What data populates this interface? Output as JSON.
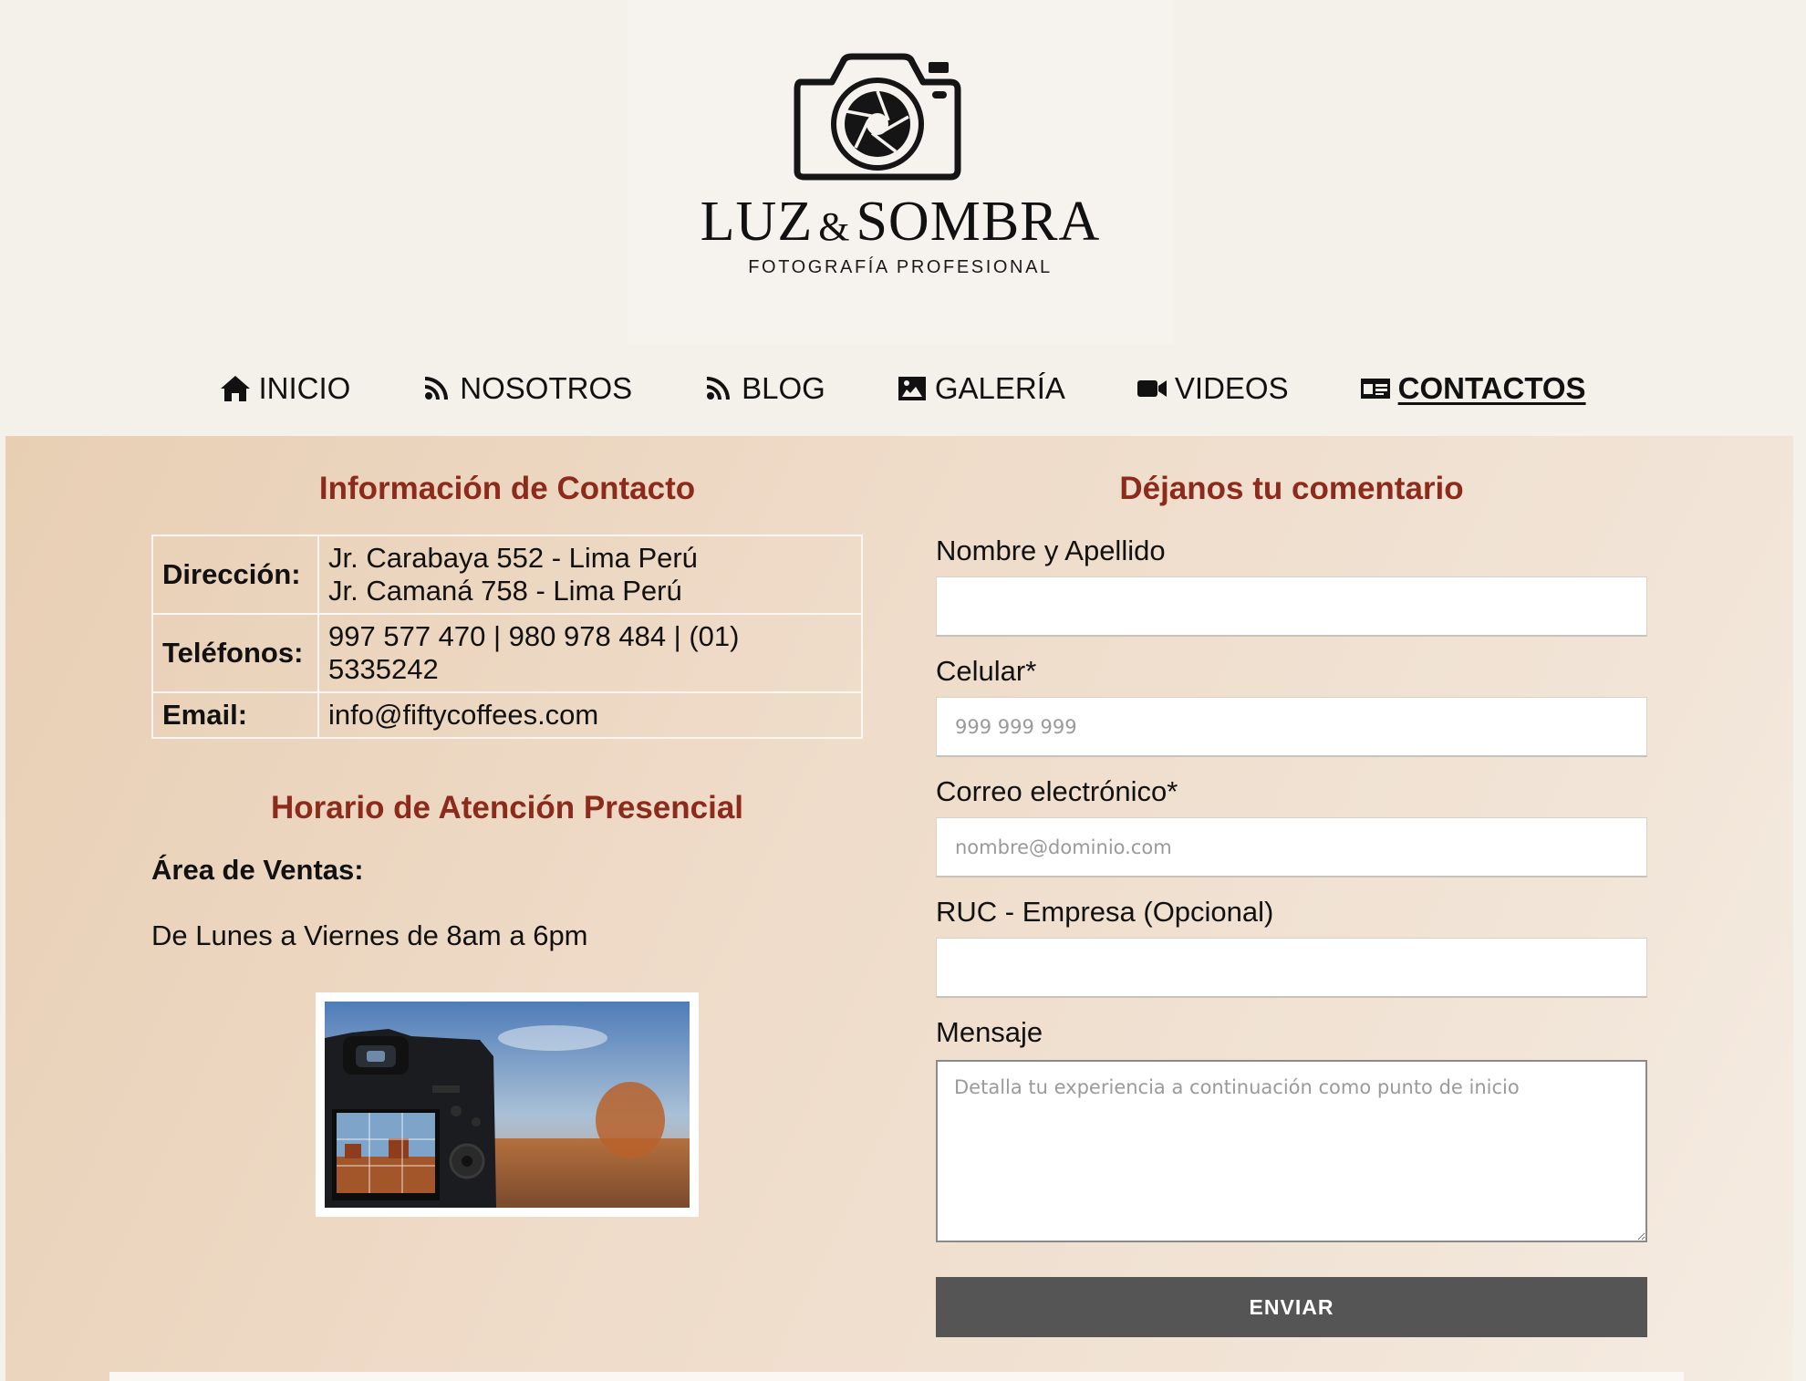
{
  "brand": {
    "name_left": "LUZ",
    "ampersand": "&",
    "name_right": "SOMBRA",
    "tagline": "FOTOGRAFÍA PROFESIONAL"
  },
  "nav": {
    "items": [
      {
        "label": "INICIO",
        "icon": "home-icon"
      },
      {
        "label": "NOSOTROS",
        "icon": "rss-icon"
      },
      {
        "label": "BLOG",
        "icon": "rss-icon"
      },
      {
        "label": "GALERÍA",
        "icon": "image-icon"
      },
      {
        "label": "VIDEOS",
        "icon": "video-icon"
      },
      {
        "label": "CONTACTOS",
        "icon": "id-card-icon",
        "active": true
      }
    ]
  },
  "contact": {
    "heading": "Información de Contacto",
    "rows": [
      {
        "label": "Dirección:",
        "lines": [
          "Jr. Carabaya 552 - Lima Perú",
          "Jr. Camaná 758 - Lima Perú"
        ]
      },
      {
        "label": "Teléfonos:",
        "lines": [
          "997 577 470 | 980 978 484 | (01)",
          "5335242"
        ]
      },
      {
        "label": "Email:",
        "lines": [
          "info@fiftycoffees.com"
        ]
      }
    ]
  },
  "hours": {
    "heading": "Horario de Atención Presencial",
    "area_label": "Área de Ventas:",
    "schedule": "De Lunes a Viernes de 8am a 6pm"
  },
  "form": {
    "heading": "Déjanos tu comentario",
    "name_label": "Nombre y Apellido",
    "name_placeholder": "",
    "phone_label": "Celular*",
    "phone_placeholder": "999 999 999",
    "email_label": "Correo electrónico*",
    "email_placeholder": "nombre@dominio.com",
    "ruc_label": "RUC - Empresa (Opcional)",
    "ruc_placeholder": "",
    "message_label": "Mensaje",
    "message_placeholder": "Detalla tu experiencia a continuación como punto de inicio",
    "submit_label": "ENVIAR"
  },
  "colors": {
    "heading": "#8c2a1c",
    "button": "#555555",
    "background_start": "#e8cfb4",
    "background_end": "#f5ece2"
  }
}
